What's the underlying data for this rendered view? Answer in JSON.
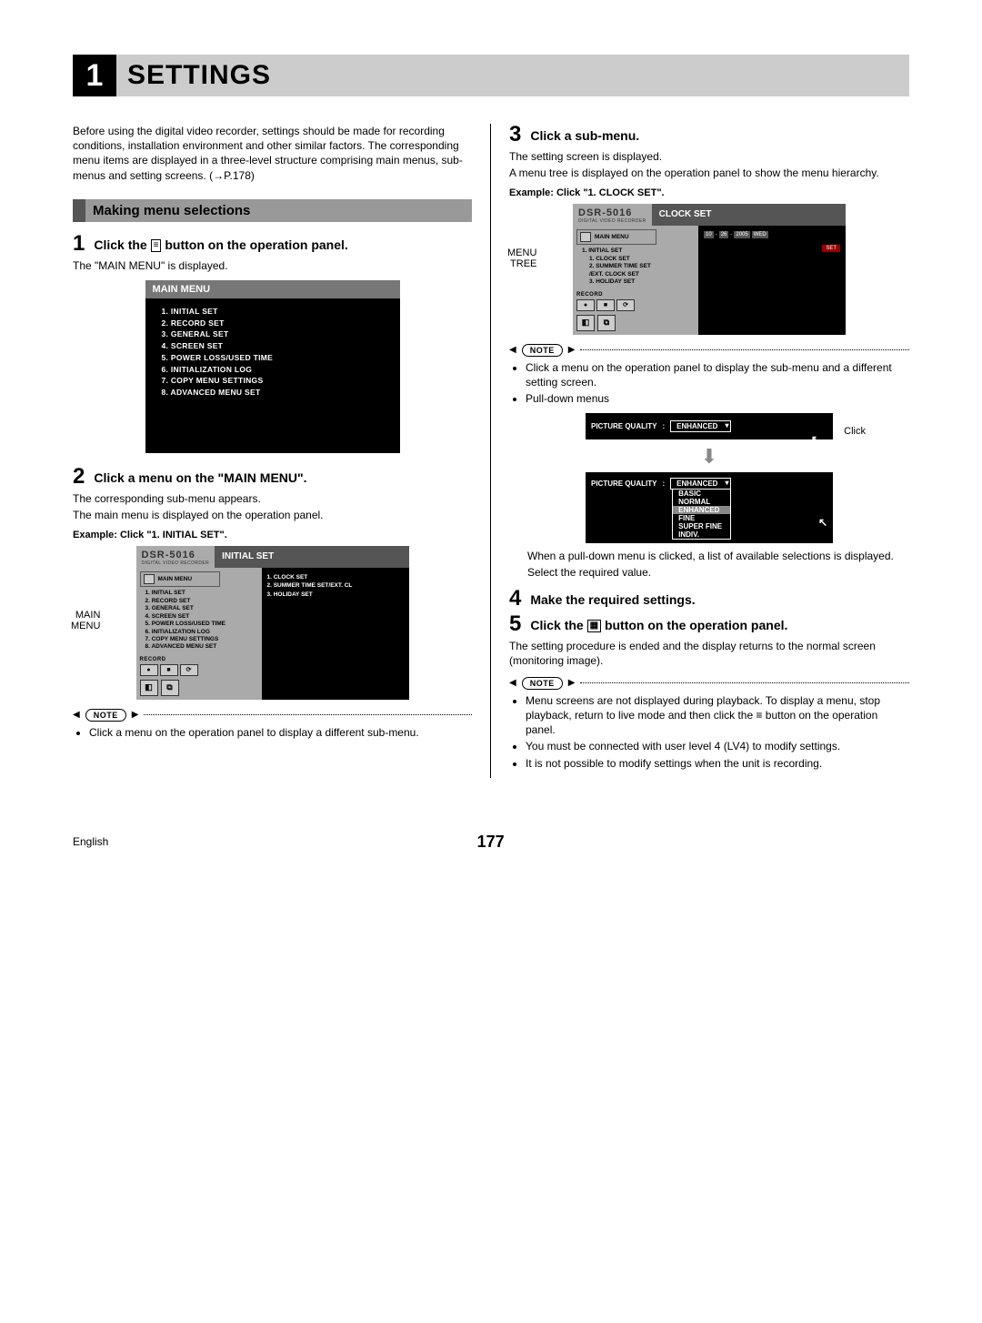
{
  "chapter": {
    "num": "1",
    "title": "SETTINGS"
  },
  "intro": "Before using the digital video recorder, settings should be made for recording conditions, installation environment and other similar factors. The corresponding menu items are displayed in a three-level structure comprising main menus, sub-menus and setting screens. (→P.178)",
  "section_heading": "Making menu selections",
  "step1": {
    "num": "1",
    "title_pre": "Click the ",
    "title_post": " button on the operation panel.",
    "icon_glyph": "≡",
    "body": "The \"MAIN MENU\" is displayed."
  },
  "main_menu": {
    "header": "MAIN MENU",
    "items": [
      "1.  INITIAL SET",
      "2.  RECORD SET",
      "3.  GENERAL SET",
      "4.  SCREEN SET",
      "5.  POWER LOSS/USED TIME",
      "6.  INITIALIZATION LOG",
      "7.  COPY MENU SETTINGS",
      "8.  ADVANCED MENU SET"
    ]
  },
  "step2": {
    "num": "2",
    "title": "Click a menu on the \"MAIN MENU\".",
    "body1": "The corresponding sub-menu appears.",
    "body2": "The main menu is displayed on the operation panel.",
    "example": "Example: Click \"1. INITIAL SET\"."
  },
  "dsr_initial": {
    "brand": "DSR-5016",
    "subtitle": "DIGITAL VIDEO RECORDER",
    "panel_title": "INITIAL SET",
    "mm_label": "MAIN MENU",
    "side_list": [
      "1. INITIAL SET",
      "2. RECORD SET",
      "3. GENERAL SET",
      "4. SCREEN SET",
      "5. POWER LOSS/USED TIME",
      "6. INITIALIZATION LOG",
      "7. COPY MENU SETTINGS",
      "8. ADVANCED MENU SET"
    ],
    "main_list": [
      "1.  CLOCK SET",
      "2.  SUMMER TIME SET/EXT. CL",
      "3.  HOLIDAY SET"
    ],
    "rec": "RECORD",
    "side_label": "MAIN\nMENU"
  },
  "note1_label": "NOTE",
  "note1_bullet": "Click a menu on the operation panel to display a different sub-menu.",
  "step3": {
    "num": "3",
    "title": "Click a sub-menu.",
    "body1": "The setting screen is displayed.",
    "body2": "A menu tree is displayed on the operation panel to show the menu hierarchy.",
    "example": "Example: Click \"1. CLOCK SET\"."
  },
  "dsr_clock": {
    "brand": "DSR-5016",
    "subtitle": "DIGITAL VIDEO RECORDER",
    "panel_title": "CLOCK SET",
    "mm_label": "MAIN MENU",
    "side_label": "MENU\nTREE",
    "tree_top": "1. INITIAL SET",
    "tree_sub": [
      "1. CLOCK SET",
      "2. SUMMER TIME SET",
      "   /EXT. CLOCK SET",
      "3. HOLIDAY SET"
    ],
    "date": {
      "m": "10",
      "d": "26",
      "y": "2005",
      "dow": "WED"
    },
    "set": "SET",
    "rec": "RECORD"
  },
  "note2_label": "NOTE",
  "note2_bullets": [
    "Click a menu on the operation panel to display the sub-menu and a different setting screen.",
    "Pull-down menus"
  ],
  "pq": {
    "label": "PICTURE QUALITY",
    "sep": ":",
    "selected": "ENHANCED",
    "click": "Click",
    "options": [
      "BASIC",
      "NORMAL",
      "ENHANCED",
      "FINE",
      "SUPER FINE",
      "INDIV."
    ]
  },
  "pq_body1": "When a pull-down menu is clicked, a list of available selections is displayed.",
  "pq_body2": "Select the required value.",
  "step4": {
    "num": "4",
    "title": "Make the required settings."
  },
  "step5": {
    "num": "5",
    "title_pre": "Click the ",
    "title_post": " button on the operation panel.",
    "icon_glyph": "▦",
    "body": "The setting procedure is ended and the display returns to the normal screen (monitoring image)."
  },
  "note3_label": "NOTE",
  "note3_bullets": [
    "Menu screens are not displayed during playback. To display a menu, stop playback, return to live mode and then click the  ≡  button on the operation panel.",
    "You must be connected with user level 4 (LV4) to modify settings.",
    "It is not possible to modify settings when the unit is recording."
  ],
  "footer": {
    "lang": "English",
    "page": "177"
  }
}
